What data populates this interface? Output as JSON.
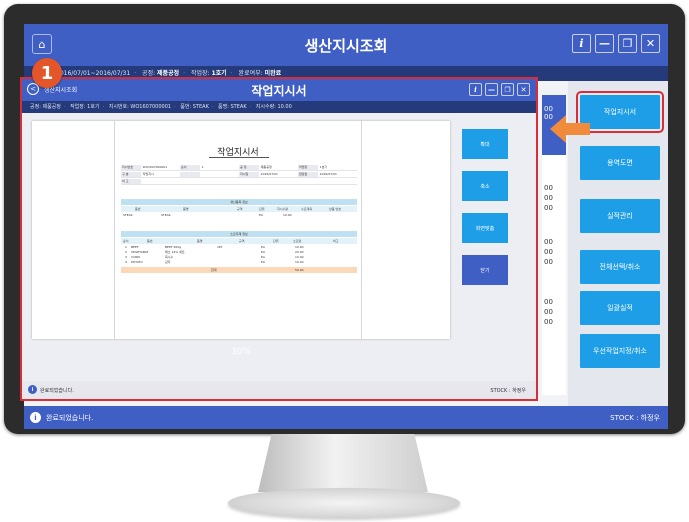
{
  "app": {
    "title": "생산지시조회",
    "home_icon": "home-icon",
    "buttons": {
      "info": "i",
      "minimize": "—",
      "restore": "❐",
      "close": "✕"
    },
    "filter": {
      "date_range": "2016/07/01~2016/07/31",
      "plant_label": "공정:",
      "plant_value": "제품공정",
      "shift_label": "작업장:",
      "shift_value": "1호기",
      "done_label": "완료여부:",
      "done_value": "미완료"
    },
    "status_text": "완료되었습니다.",
    "status_user": "STOCK : 하정우"
  },
  "side_buttons": [
    "작업지시서",
    "용역도면",
    "실적관리",
    "전체선택/취소",
    "일괄실적",
    "우선작업지정/취소"
  ],
  "bg_list_values": [
    "00",
    "00",
    "00",
    "00",
    "00",
    "00",
    "00",
    "00",
    "00",
    "00",
    "00"
  ],
  "step_badge": "1",
  "popup": {
    "back_label": "<",
    "subtitle": "생산지시조회",
    "title": "작업지시서",
    "filter": {
      "plant": "공정: 제품공정",
      "shift": "작업장: 1호기",
      "order_no": "지시번호: WO1607000001",
      "item": "품번: STEAK",
      "item_name": "품명: STEAK",
      "qty": "지시수량: 10.00"
    },
    "buttons": [
      "확대",
      "축소",
      "화면맞춤",
      "닫기"
    ],
    "zoom": "30%",
    "status_text": "완료되었습니다.",
    "status_user": "STOCK : 하정우"
  },
  "document": {
    "title": "작업지시서",
    "info_rows": [
      [
        "지시번호",
        "WO1607000001",
        "순서",
        "1",
        "공 정",
        "제품공정",
        "작업장",
        "1호기"
      ],
      [
        "구 분",
        "작업지시",
        "",
        "",
        "지시일",
        "2016/07/01",
        "완료일",
        "2016/07/01"
      ],
      [
        "비 고",
        "",
        "",
        "",
        "",
        "",
        "",
        ""
      ]
    ],
    "product_section": "생산품목 정보",
    "product_headers": [
      "품번",
      "품명",
      "규격",
      "단위",
      "지시수량",
      "수요계획",
      "납품 번호"
    ],
    "product_row": [
      "STEAK",
      "STEAK",
      "",
      "EA",
      "10.00",
      "",
      ""
    ],
    "material_section": "소요자재 정보",
    "material_headers": [
      "순서",
      "품번",
      "품명",
      "규격",
      "단위",
      "소요량",
      "비고"
    ],
    "material_rows": [
      [
        "1",
        "BEEF",
        "BEEF 200g",
        "1KT",
        "EA",
        "10.00",
        ""
      ],
      [
        "2",
        "VEGETABLE",
        "채소 14% 세트",
        "",
        "EA",
        "20.00",
        ""
      ],
      [
        "3",
        "CORN",
        "옥수수",
        "",
        "EA",
        "10.00",
        ""
      ],
      [
        "4",
        "POTATO",
        "감자",
        "",
        "EA",
        "10.00",
        ""
      ]
    ],
    "total_label": "합계",
    "total_value": "50.00"
  },
  "colors": {
    "accent": "#3f5fc4",
    "button": "#1e9ee6",
    "highlight": "#d92d3a",
    "badge": "#e4562a"
  }
}
